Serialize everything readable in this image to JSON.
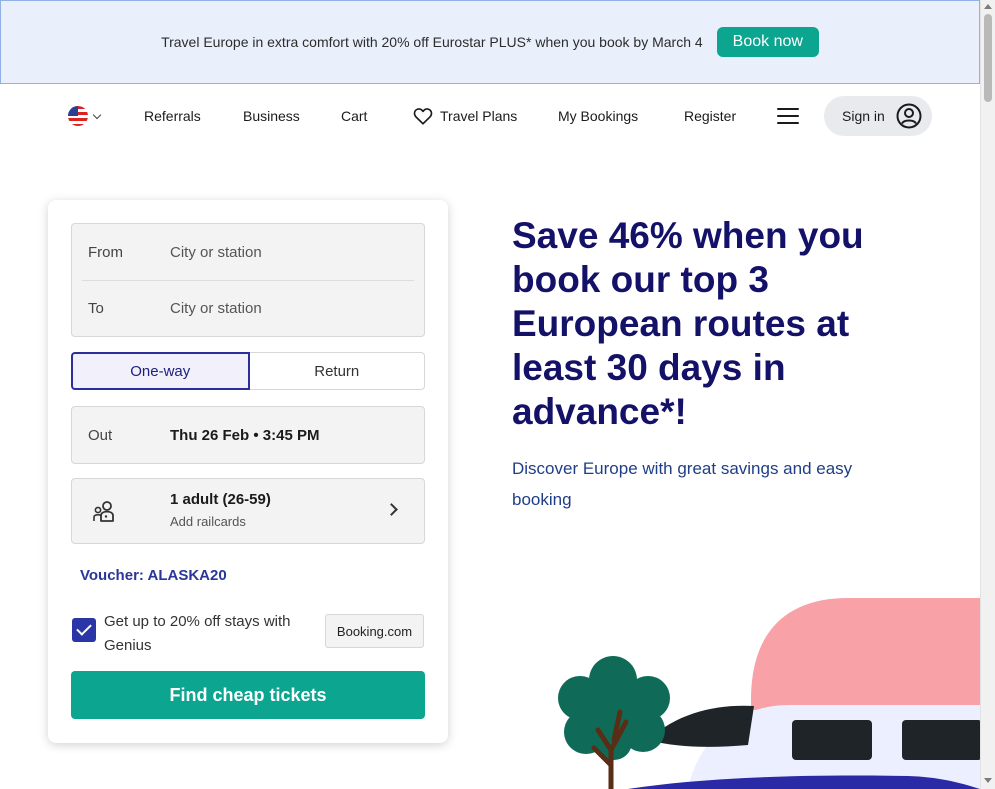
{
  "promo": {
    "text": "Travel Europe in extra comfort with 20% off Eurostar PLUS* when you book by March 4",
    "button": "Book now"
  },
  "nav": {
    "locale_icon": "us-flag-icon",
    "items": [
      "Referrals",
      "Business",
      "Cart",
      "Travel Plans",
      "My Bookings",
      "Register"
    ],
    "sign_in": "Sign in"
  },
  "search": {
    "from_label": "From",
    "from_placeholder": "City or station",
    "to_label": "To",
    "to_placeholder": "City or station",
    "trip_types": [
      "One-way",
      "Return"
    ],
    "selected_trip_type": "One-way",
    "out_label": "Out",
    "out_value": "Thu 26 Feb • 3:45 PM",
    "passengers": "1 adult (26-59)",
    "railcards": "Add railcards",
    "voucher": "Voucher: ALASKA20",
    "genius_text": "Get up to 20% off stays with Genius",
    "genius_checked": true,
    "genius_partner": "Booking.com",
    "cta": "Find cheap tickets"
  },
  "hero": {
    "title": "Save 46% when you book our top 3 European routes at least 30 days in advance*!",
    "subtitle": "Discover Europe with great savings and easy booking"
  },
  "colors": {
    "accent": "#0ca58f",
    "headline": "#141169",
    "link": "#2a3798",
    "banner_bg": "#eaf0fb"
  }
}
